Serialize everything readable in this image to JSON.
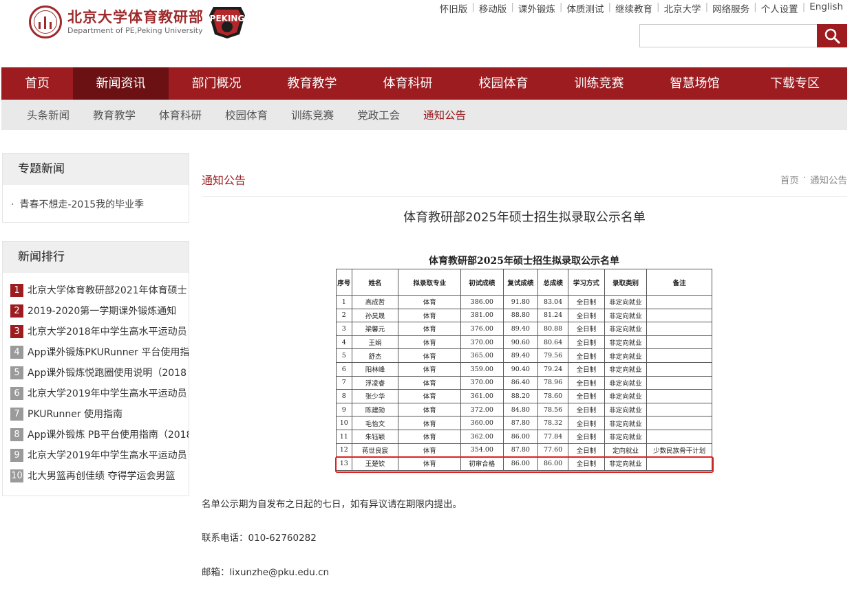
{
  "header": {
    "logo_cn": "北京大学体育教研部",
    "logo_en": "Department of PE,Peking University",
    "badge_text": "PEKING",
    "top_links": [
      "怀旧版",
      "移动版",
      "课外锻炼",
      "体质测试",
      "继续教育",
      "北京大学",
      "网络服务",
      "个人设置",
      "English"
    ],
    "search_placeholder": ""
  },
  "main_nav": [
    "首页",
    "新闻资讯",
    "部门概况",
    "教育教学",
    "体育科研",
    "校园体育",
    "训练竞赛",
    "智慧场馆",
    "下载专区"
  ],
  "main_nav_active": 1,
  "sub_nav": [
    "头条新闻",
    "教育教学",
    "体育科研",
    "校园体育",
    "训练竞赛",
    "党政工会",
    "通知公告"
  ],
  "sub_nav_active": 6,
  "sidebar": {
    "special_title": "专题新闻",
    "special_items": [
      "青春不想走-2015我的毕业季"
    ],
    "rank_title": "新闻排行",
    "rank_items": [
      "北京大学体育教研部2021年体育硕士",
      "2019-2020第一学期课外锻炼通知",
      "北京大学2018年中学生高水平运动员",
      "App课外锻炼PKURunner 平台使用指",
      "App课外锻炼悦跑圈使用说明（2018",
      "北京大学2019年中学生高水平运动员",
      "PKURunner 使用指南",
      "App课外锻炼 PB平台使用指南（2018",
      "北京大学2019年中学生高水平运动员",
      "北大男篮再创佳绩 夺得学运会男篮"
    ]
  },
  "content": {
    "section": "通知公告",
    "breadcrumb": [
      "首页",
      "·",
      "通知公告"
    ],
    "title": "体育教研部2025年硕士招生拟录取公示名单",
    "table_title": "体育教研部2025年硕士招生拟录取公示名单",
    "columns": [
      "序号",
      "姓名",
      "拟录取专业",
      "初试成绩",
      "复试成绩",
      "总成绩",
      "学习方式",
      "录取类别",
      "备注"
    ],
    "rows": [
      [
        "1",
        "高成哲",
        "体育",
        "386.00",
        "91.80",
        "83.04",
        "全日制",
        "非定向就业",
        ""
      ],
      [
        "2",
        "孙昊晟",
        "体育",
        "381.00",
        "88.80",
        "81.24",
        "全日制",
        "非定向就业",
        ""
      ],
      [
        "3",
        "梁馨元",
        "体育",
        "376.00",
        "89.40",
        "80.88",
        "全日制",
        "非定向就业",
        ""
      ],
      [
        "4",
        "王娟",
        "体育",
        "370.00",
        "90.60",
        "80.64",
        "全日制",
        "非定向就业",
        ""
      ],
      [
        "5",
        "舒杰",
        "体育",
        "365.00",
        "89.40",
        "79.56",
        "全日制",
        "非定向就业",
        ""
      ],
      [
        "6",
        "阳林峰",
        "体育",
        "359.00",
        "90.40",
        "79.24",
        "全日制",
        "非定向就业",
        ""
      ],
      [
        "7",
        "浮凌睿",
        "体育",
        "370.00",
        "86.40",
        "78.96",
        "全日制",
        "非定向就业",
        ""
      ],
      [
        "8",
        "张少华",
        "体育",
        "361.00",
        "88.20",
        "78.60",
        "全日制",
        "非定向就业",
        ""
      ],
      [
        "9",
        "陈建勋",
        "体育",
        "372.00",
        "84.80",
        "78.56",
        "全日制",
        "非定向就业",
        ""
      ],
      [
        "10",
        "毛怡文",
        "体育",
        "360.00",
        "87.80",
        "78.32",
        "全日制",
        "非定向就业",
        ""
      ],
      [
        "11",
        "朱钰颖",
        "体育",
        "362.00",
        "86.00",
        "77.84",
        "全日制",
        "非定向就业",
        ""
      ],
      [
        "12",
        "蒋世良宸",
        "体育",
        "354.00",
        "87.80",
        "77.60",
        "全日制",
        "定向就业",
        "少数民族骨干计划"
      ],
      [
        "13",
        "王楚钦",
        "体育",
        "初审合格",
        "86.00",
        "86.00",
        "全日制",
        "非定向就业",
        ""
      ]
    ],
    "notice": "名单公示期为自发布之日起的七日，如有异议请在期限内提出。",
    "phone": "联系电话：010-62760282",
    "email": "邮箱：lixunzhe@pku.edu.cn"
  },
  "colors": {
    "brand_red": "#9c1c20",
    "active_nav": "#6b1013",
    "highlight_border": "#e02020"
  }
}
